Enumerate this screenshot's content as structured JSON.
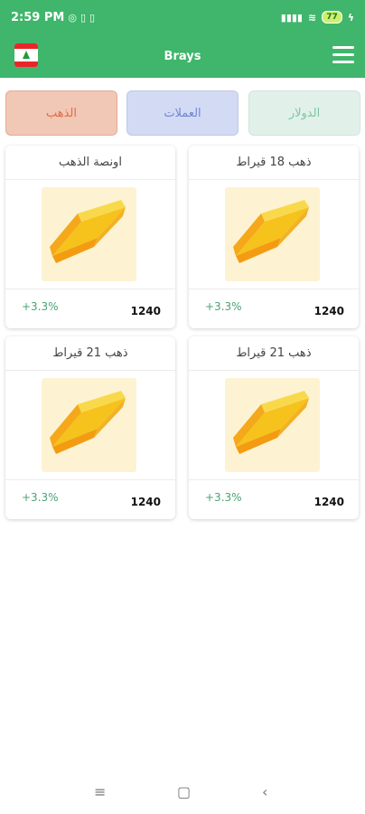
{
  "status_bar": {
    "time": "2:59 PM",
    "signal": "▮▮▮▮",
    "battery": "77"
  },
  "app_bar": {
    "title": "Brays",
    "flag_icon": "lebanon-flag-icon",
    "menu_icon": "hamburger-menu-icon",
    "color": "#3fb66b"
  },
  "tabs": [
    {
      "label": "الذهب",
      "color": "#e06d44"
    },
    {
      "label": "العملات",
      "color": "#6e86d6"
    },
    {
      "label": "الدولار",
      "color": "#7fc5a0"
    }
  ],
  "cards": [
    {
      "name": "اونصة الذهب",
      "change": "+3.3%",
      "price": "1240",
      "icon": "gold-bar-icon"
    },
    {
      "name": "ذهب 18 قيراط",
      "change": "+3.3%",
      "price": "1240",
      "icon": "gold-bar-icon"
    },
    {
      "name": "ذهب 21 قيراط",
      "change": "+3.3%",
      "price": "1240",
      "icon": "gold-bar-icon"
    },
    {
      "name": "ذهب 21 قيراط",
      "change": "+3.3%",
      "price": "1240",
      "icon": "gold-bar-icon"
    }
  ],
  "nav_bar": {
    "recent_icon": "recent-apps-icon",
    "home_icon": "home-icon",
    "back_icon": "back-icon"
  }
}
